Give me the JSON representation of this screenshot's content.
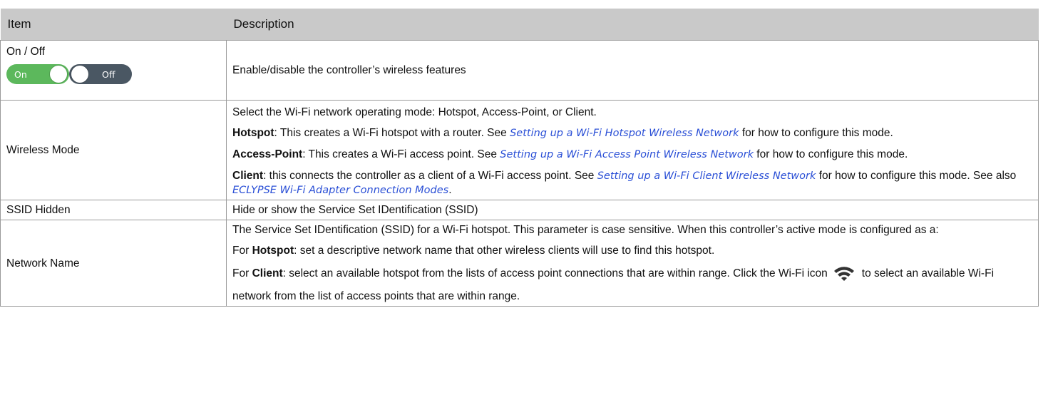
{
  "table": {
    "headers": [
      "Item",
      "Description"
    ],
    "rows": {
      "onoff": {
        "item": "On / Off",
        "toggle_on_label": "On",
        "toggle_off_label": "Off",
        "description": "Enable/disable the controller’s wireless features"
      },
      "wireless_mode": {
        "item": "Wireless Mode",
        "intro": "Select the Wi-Fi network operating mode: Hotspot, Access-Point, or Client.",
        "hotspot": {
          "term": "Hotspot",
          "text1": ": This creates a Wi-Fi hotspot with a router. See ",
          "link": "Setting up a Wi-Fi Hotspot Wireless Network",
          "text2": " for how to configure this mode."
        },
        "access_point": {
          "term": "Access-Point",
          "text1": ": This creates a Wi-Fi access point. See ",
          "link": "Setting up a Wi-Fi Access Point Wireless Network",
          "text2": " for how to configure this mode."
        },
        "client": {
          "term": "Client",
          "text1": ": this connects the controller as a client of a Wi-Fi access point. See ",
          "link": "Setting up a Wi-Fi Client Wireless Network",
          "text2": " for how to configure this mode. See also ",
          "link2": "ECLYPSE Wi-Fi Adapter Connection Modes",
          "text3": "."
        }
      },
      "ssid_hidden": {
        "item": "SSID Hidden",
        "description": "Hide or show the Service Set IDentification (SSID)"
      },
      "network_name": {
        "item": "Network Name",
        "intro": "The Service Set IDentification (SSID) for a Wi-Fi hotspot. This parameter is case sensitive. When this controller’s active mode is configured as a:",
        "hotspot": {
          "prefix": "For ",
          "term": "Hotspot",
          "text": ": set a descriptive network name that other wireless clients will use to find this hotspot."
        },
        "client": {
          "prefix": "For ",
          "term": "Client",
          "text1": ": select an available hotspot from the lists of access point connections that are within range. Click the Wi-Fi icon",
          "text2": "to select an available Wi-Fi network from the list of access points that are within range."
        }
      }
    }
  },
  "colors": {
    "header_bg": "#c9c9c9",
    "link": "#2a4fd6",
    "toggle_on": "#5cb85c",
    "toggle_off": "#4a5763"
  },
  "icons": [
    "wifi-icon"
  ]
}
